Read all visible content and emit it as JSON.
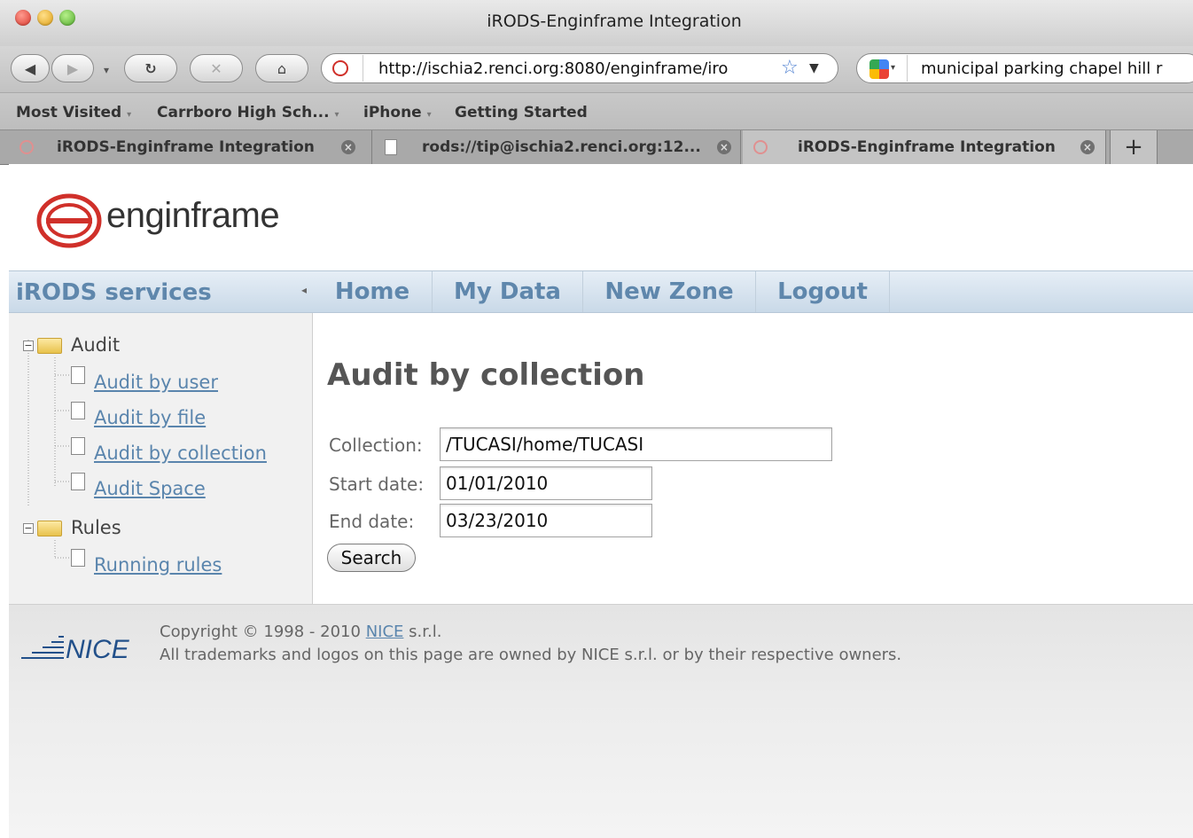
{
  "window": {
    "title": "iRODS-Enginframe Integration"
  },
  "toolbar": {
    "url": "http://ischia2.renci.org:8080/enginframe/iro",
    "search_text": "municipal parking chapel hill r"
  },
  "bookmarks": [
    {
      "label": "Most Visited",
      "has_dropdown": true
    },
    {
      "label": "Carrboro High Sch...",
      "has_dropdown": true
    },
    {
      "label": "iPhone",
      "has_dropdown": true
    },
    {
      "label": "Getting Started",
      "has_dropdown": false
    }
  ],
  "tabs": [
    {
      "label": "iRODS-Enginframe Integration",
      "active": false
    },
    {
      "label": "rods://tip@ischia2.renci.org:12...",
      "active": false
    },
    {
      "label": "iRODS-Enginframe Integration",
      "active": true
    }
  ],
  "new_tab_label": "+",
  "header": {
    "logo_text": "enginframe"
  },
  "sidebar": {
    "title": "iRODS services",
    "groups": [
      {
        "label": "Audit",
        "items": [
          "Audit by user",
          "Audit by file",
          "Audit by collection",
          "Audit Space"
        ]
      },
      {
        "label": "Rules",
        "items": [
          "Running rules"
        ]
      }
    ]
  },
  "nav": {
    "items": [
      "Home",
      "My Data",
      "New Zone",
      "Logout"
    ]
  },
  "main": {
    "title": "Audit by collection",
    "form": {
      "collection_label": "Collection:",
      "collection_value": "/TUCASI/home/TUCASI",
      "start_label": "Start date:",
      "start_value": "01/01/2010",
      "end_label": "End date:",
      "end_value": "03/23/2010",
      "search_label": "Search"
    }
  },
  "footer": {
    "logo_text": "NICE",
    "copyright_prefix": "Copyright © 1998 - 2010",
    "copyright_link": "NICE",
    "copyright_suffix": "s.r.l.",
    "trademark": "All trademarks and logos on this page are owned by NICE s.r.l. or by their respective owners."
  },
  "colors": {
    "accent_blue": "#5f87ac",
    "link_blue": "#5a85ad",
    "logo_red": "#d0302a"
  }
}
